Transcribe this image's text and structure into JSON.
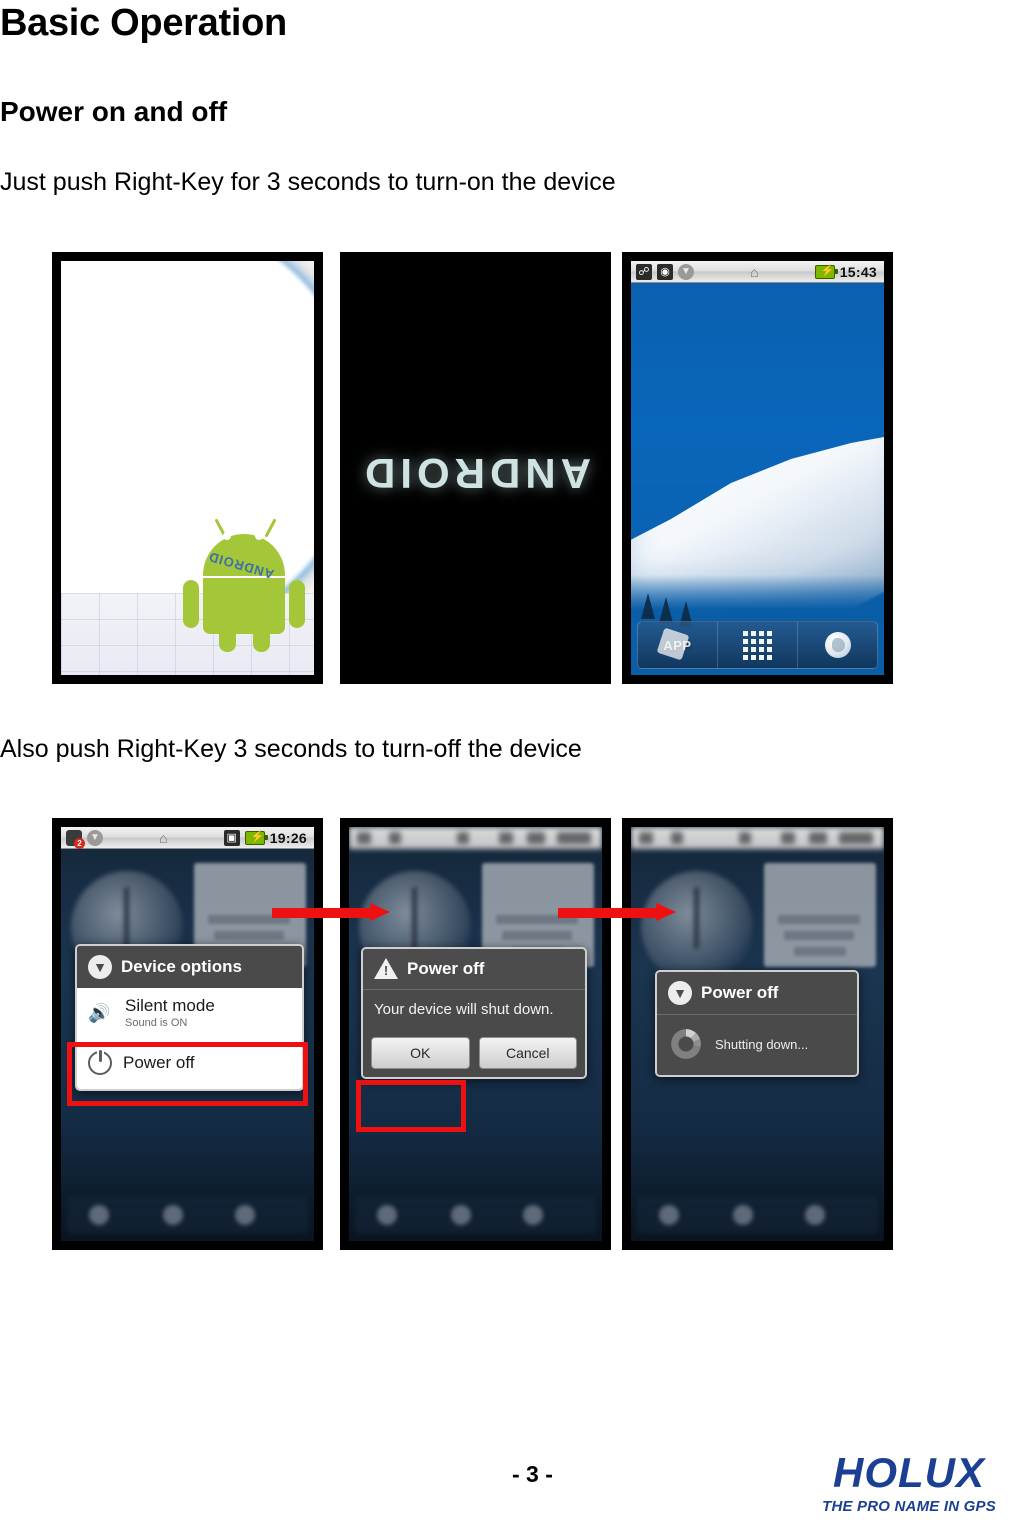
{
  "document": {
    "title": "Basic Operation",
    "section_heading": "Power on and off",
    "paragraph_power_on": "Just push Right-Key for 3 seconds to turn-on the device",
    "paragraph_power_off": "Also push Right-Key 3 seconds to turn-off the device",
    "page_number": "- 3 -"
  },
  "brand": {
    "name": "HOLUX",
    "tagline": "THE PRO NAME IN GPS",
    "color": "#1b3f93"
  },
  "colors": {
    "highlight_red": "#ee1111",
    "android_green": "#a4c639",
    "home_blue": "#0a5ea8"
  },
  "screens": {
    "boot_splash": {
      "name": "boot-splash",
      "wordmark": "ANDROID"
    },
    "boot_logo": {
      "name": "boot-logo",
      "wordmark": "ANDROID"
    },
    "home": {
      "name": "home-screen",
      "statusbar": {
        "time": "15:43",
        "icons": [
          "usb-icon",
          "android-notification-icon",
          "download-icon",
          "home-icon",
          "battery-charging-icon"
        ]
      },
      "dock": {
        "app_shortcut_label": "APP",
        "app_drawer_icon": "app-drawer-grid-icon",
        "browser_icon": "globe-browser-icon"
      }
    },
    "device_options": {
      "name": "device-options-menu",
      "statusbar": {
        "time": "19:26",
        "notification_badge": "2",
        "icons": [
          "message-notification-icon",
          "download-icon",
          "home-icon",
          "sd-card-icon",
          "battery-charging-icon"
        ]
      },
      "dialog": {
        "title": "Device options",
        "title_icon": "chevron-down-circle-icon",
        "items": [
          {
            "label": "Silent mode",
            "sublabel": "Sound is ON",
            "icon": "speaker-icon",
            "highlighted": false
          },
          {
            "label": "Power off",
            "sublabel": "",
            "icon": "power-icon",
            "highlighted": true
          }
        ]
      }
    },
    "power_off_confirm": {
      "name": "power-off-confirm-dialog",
      "dialog": {
        "title": "Power off",
        "title_icon": "warning-triangle-icon",
        "message": "Your device will shut down.",
        "buttons": [
          {
            "label": "OK",
            "highlighted": true
          },
          {
            "label": "Cancel",
            "highlighted": false
          }
        ]
      }
    },
    "shutting_down": {
      "name": "shutting-down-dialog",
      "dialog": {
        "title": "Power off",
        "title_icon": "chevron-down-circle-icon",
        "progress_text": "Shutting down...",
        "progress_icon": "spinner-icon"
      }
    }
  }
}
